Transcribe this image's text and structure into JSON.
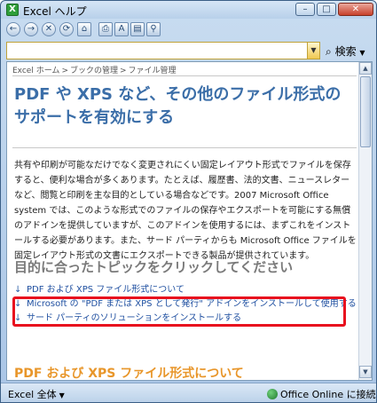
{
  "window": {
    "title": "Excel ヘルプ",
    "controls": {
      "minimize": "–",
      "maximize": "□",
      "close": "✕"
    }
  },
  "toolbar": {
    "items": [
      {
        "name": "back",
        "icon": "back-arrow-icon",
        "glyph": "←"
      },
      {
        "name": "forward",
        "icon": "forward-arrow-icon",
        "glyph": "→"
      },
      {
        "name": "stop",
        "icon": "stop-icon",
        "glyph": "✕"
      },
      {
        "name": "refresh",
        "icon": "refresh-icon",
        "glyph": "⟳"
      },
      {
        "name": "home",
        "icon": "home-icon",
        "glyph": "⌂"
      },
      {
        "name": "print",
        "icon": "printer-icon",
        "glyph": "⎙"
      },
      {
        "name": "font-size",
        "icon": "font-size-icon",
        "glyph": "A"
      },
      {
        "name": "toc",
        "icon": "book-icon",
        "glyph": "▤"
      },
      {
        "name": "keep-on-top",
        "icon": "pin-icon",
        "glyph": "⚲"
      }
    ]
  },
  "search": {
    "value": "",
    "placeholder": "",
    "button_label": "検索"
  },
  "breadcrumb": [
    "Excel ホーム",
    "ブックの管理",
    "ファイル管理"
  ],
  "breadcrumb_separator": ">",
  "page": {
    "title": "PDF や XPS など、その他のファイル形式のサポートを有効にする",
    "body": "共有や印刷が可能なだけでなく変更されにくい固定レイアウト形式でファイルを保存すると、便利な場合が多くあります。たとえば、履歴書、法的文書、ニュースレターなど、閲覧と印刷を主な目的としている場合などです。2007 Microsoft Office system では、このような形式でのファイルの保存やエクスポートを可能にする無償のアドインを提供していますが、このアドインを使用するには、まずこれをインストールする必要があります。また、サード パーティからも Microsoft Office ファイルを固定レイアウト形式の文書にエクスポートできる製品が提供されています。",
    "topics_heading": "目的に合ったトピックをクリックしてください",
    "topics": [
      "PDF および XPS ファイル形式について",
      "Microsoft の \"PDF または XPS として発行\" アドインをインストールして使用する",
      "サード パーティのソリューションをインストールする"
    ],
    "section2_heading": "PDF および XPS ファイル形式について"
  },
  "status": {
    "left": "Excel 全体",
    "right": "Office Online に接続"
  },
  "colors": {
    "title": "#3b6ea8",
    "link": "#1f4fa0",
    "highlight": "#e8101e",
    "section2": "#e8962a"
  }
}
